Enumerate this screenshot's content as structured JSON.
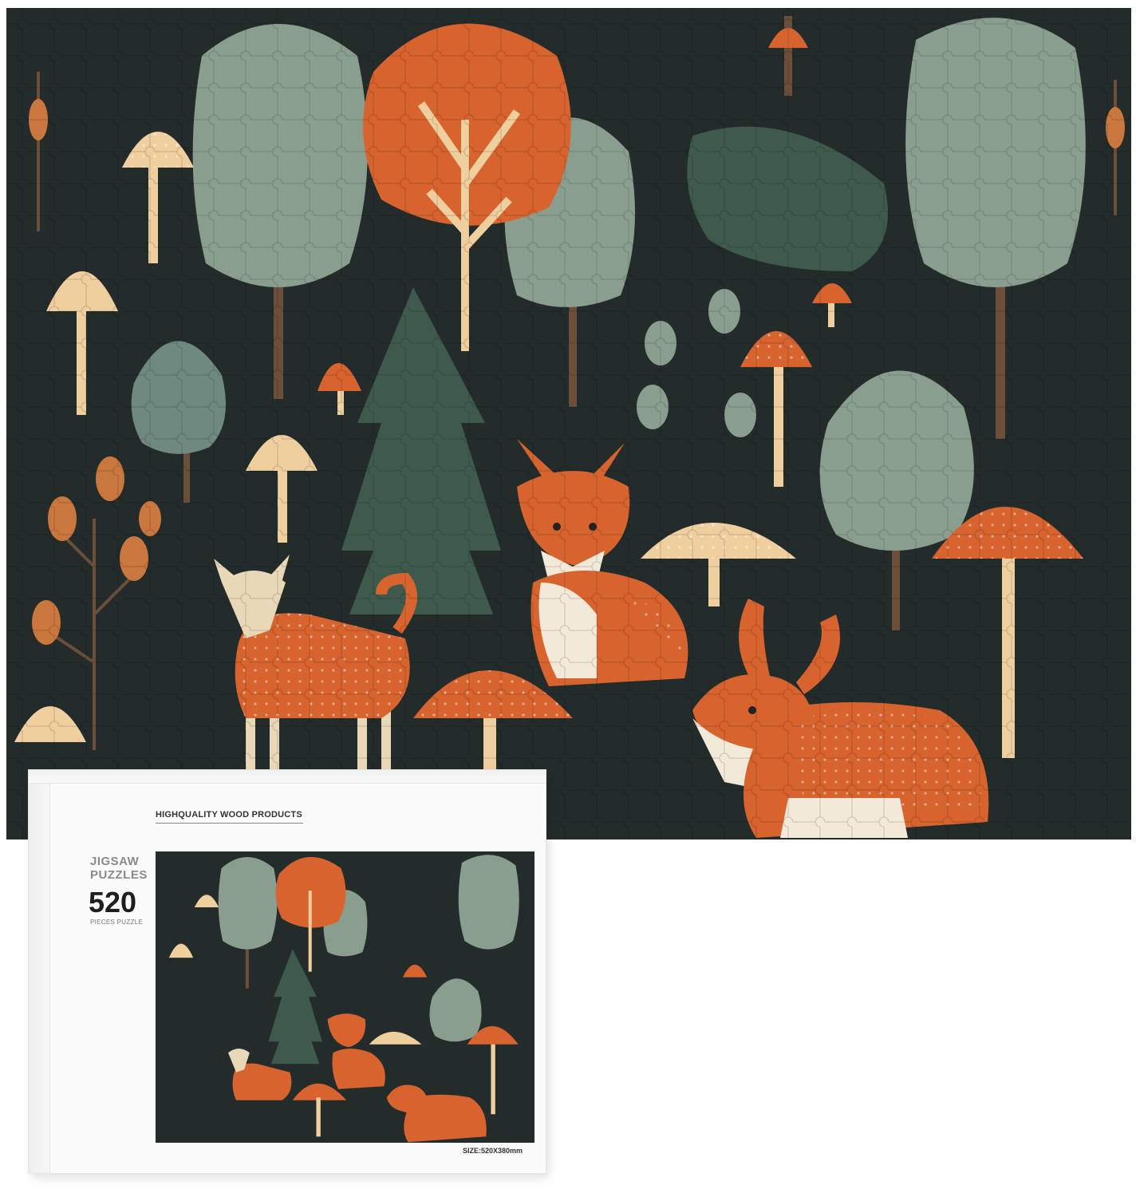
{
  "box": {
    "tagline": "HIGHQUALITY WOOD PRODUCTS",
    "brand_line1": "JIGSAW",
    "brand_line2": "PUZZLES",
    "piece_count": "520",
    "piece_sub": "PIECES PUZZLE",
    "size_label": "SIZE:520X380mm"
  },
  "colors": {
    "background": "#242b2b",
    "sage": "#8a9e8f",
    "orange": "#d7632e",
    "cream": "#efcf9e",
    "trunk": "#6b4f3a",
    "pine": "#3e5a4c"
  }
}
